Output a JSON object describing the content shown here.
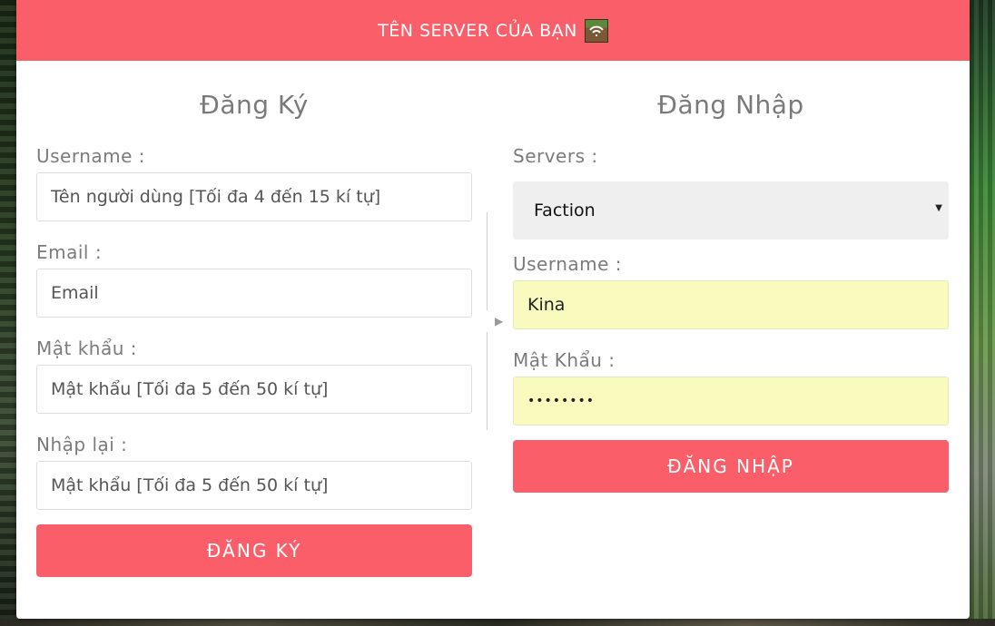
{
  "header": {
    "title": "TÊN SERVER CỦA BẠN",
    "icon": "minecraft-grass-block-icon",
    "color": "#fa5f69"
  },
  "register": {
    "title": "Đăng Ký",
    "username_label": "Username :",
    "username_placeholder": "Tên người dùng [Tối đa 4 đến 15 kí tự]",
    "email_label": "Email :",
    "email_placeholder": "Email",
    "password_label": "Mật khẩu :",
    "password_placeholder": "Mật khẩu [Tối đa 5 đến 50 kí tự]",
    "confirm_label": "Nhập lại :",
    "confirm_placeholder": "Mật khẩu [Tối đa 5 đến 50 kí tự]",
    "submit_label": "ĐĂNG KÝ"
  },
  "login": {
    "title": "Đăng Nhập",
    "servers_label": "Servers :",
    "server_selected": "Faction",
    "username_label": "Username :",
    "username_value": "Kina",
    "password_label": "Mật Khẩu :",
    "password_value": "••••••••",
    "submit_label": "ĐĂNG NHẬP"
  },
  "divider": {
    "arrow_icon": "triangle-right-icon"
  }
}
